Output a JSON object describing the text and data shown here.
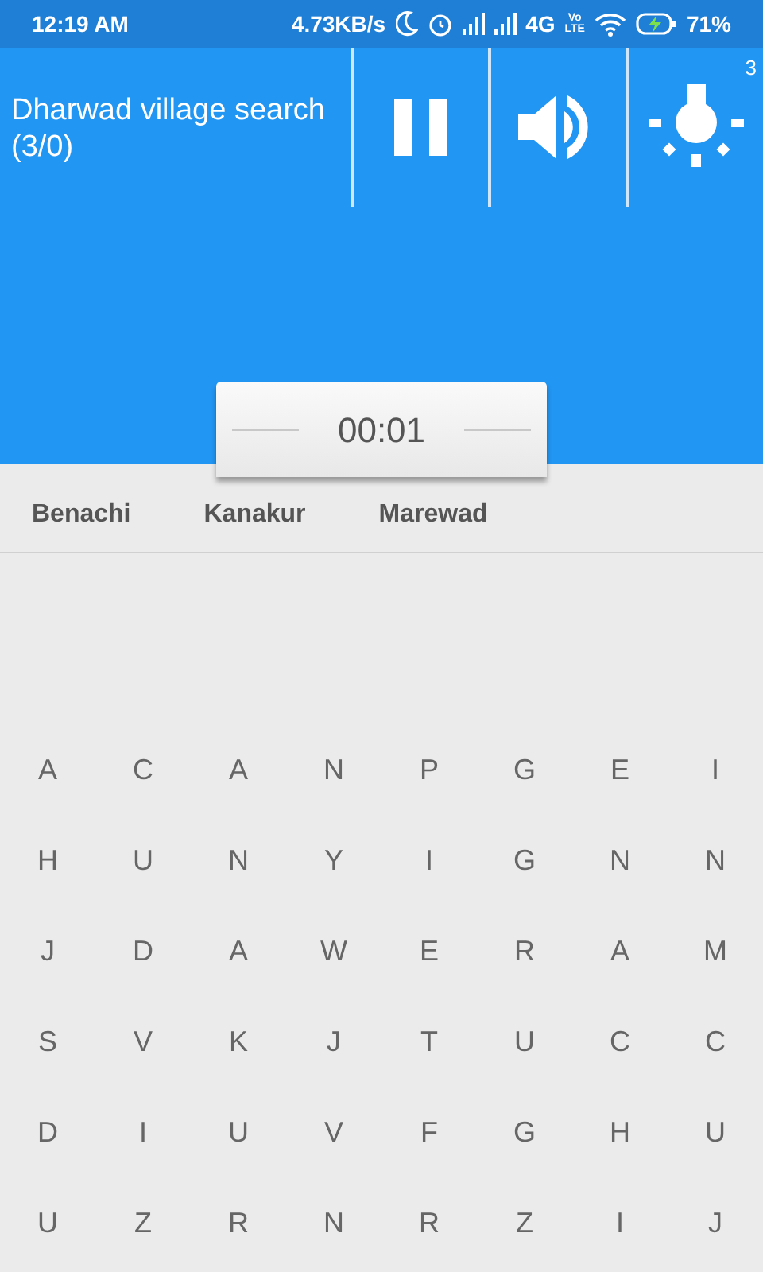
{
  "status_bar": {
    "time": "12:19 AM",
    "speed": "4.73KB/s",
    "network": "4G",
    "volte": [
      "Vo",
      "LTE"
    ],
    "battery": "71%"
  },
  "header": {
    "title": "Dharwad village search (3/0)",
    "controls": [
      {
        "kind": "pause"
      },
      {
        "kind": "sound"
      },
      {
        "kind": "hint",
        "badge": "3"
      }
    ]
  },
  "timer": "00:01",
  "found_words": [
    "Benachi",
    "Kanakur",
    "Marewad"
  ],
  "letter_grid": [
    [
      "A",
      "C",
      "A",
      "N",
      "P",
      "G",
      "E",
      "I"
    ],
    [
      "H",
      "U",
      "N",
      "Y",
      "I",
      "G",
      "N",
      "N"
    ],
    [
      "J",
      "D",
      "A",
      "W",
      "E",
      "R",
      "A",
      "M"
    ],
    [
      "S",
      "V",
      "K",
      "J",
      "T",
      "U",
      "C",
      "C"
    ],
    [
      "D",
      "I",
      "U",
      "V",
      "F",
      "G",
      "H",
      "U"
    ],
    [
      "U",
      "Z",
      "R",
      "N",
      "R",
      "Z",
      "I",
      "J"
    ]
  ]
}
